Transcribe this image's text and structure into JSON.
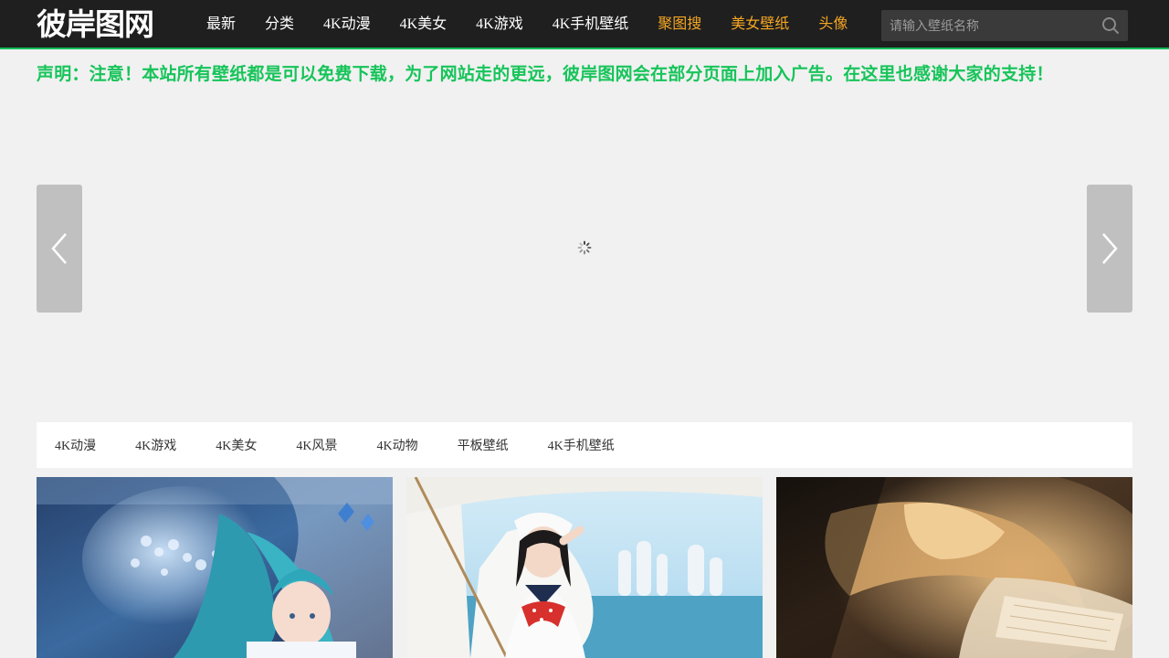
{
  "header": {
    "logo_text": "彼岸图网",
    "nav": [
      {
        "label": "最新",
        "hot": false
      },
      {
        "label": "分类",
        "hot": false
      },
      {
        "label": "4K动漫",
        "hot": false
      },
      {
        "label": "4K美女",
        "hot": false
      },
      {
        "label": "4K游戏",
        "hot": false
      },
      {
        "label": "4K手机壁纸",
        "hot": false
      },
      {
        "label": "聚图搜",
        "hot": true
      },
      {
        "label": "美女壁纸",
        "hot": true
      },
      {
        "label": "头像",
        "hot": true
      }
    ],
    "search": {
      "placeholder": "请输入壁纸名称",
      "value": ""
    }
  },
  "notice": "声明：注意！本站所有壁纸都是可以免费下载，为了网站走的更远，彼岸图网会在部分页面上加入广告。在这里也感谢大家的支持！",
  "categories": [
    "4K动漫",
    "4K游戏",
    "4K美女",
    "4K风景",
    "4K动物",
    "平板壁纸",
    "4K手机壁纸"
  ],
  "colors": {
    "header_bg": "#1f1f1f",
    "accent_green": "#17c45a",
    "hot_link": "#f5a623",
    "page_bg": "#f1f1f1"
  },
  "icons": {
    "search": "search-icon",
    "prev": "chevron-left-icon",
    "next": "chevron-right-icon",
    "loading": "loading-spinner-icon"
  }
}
